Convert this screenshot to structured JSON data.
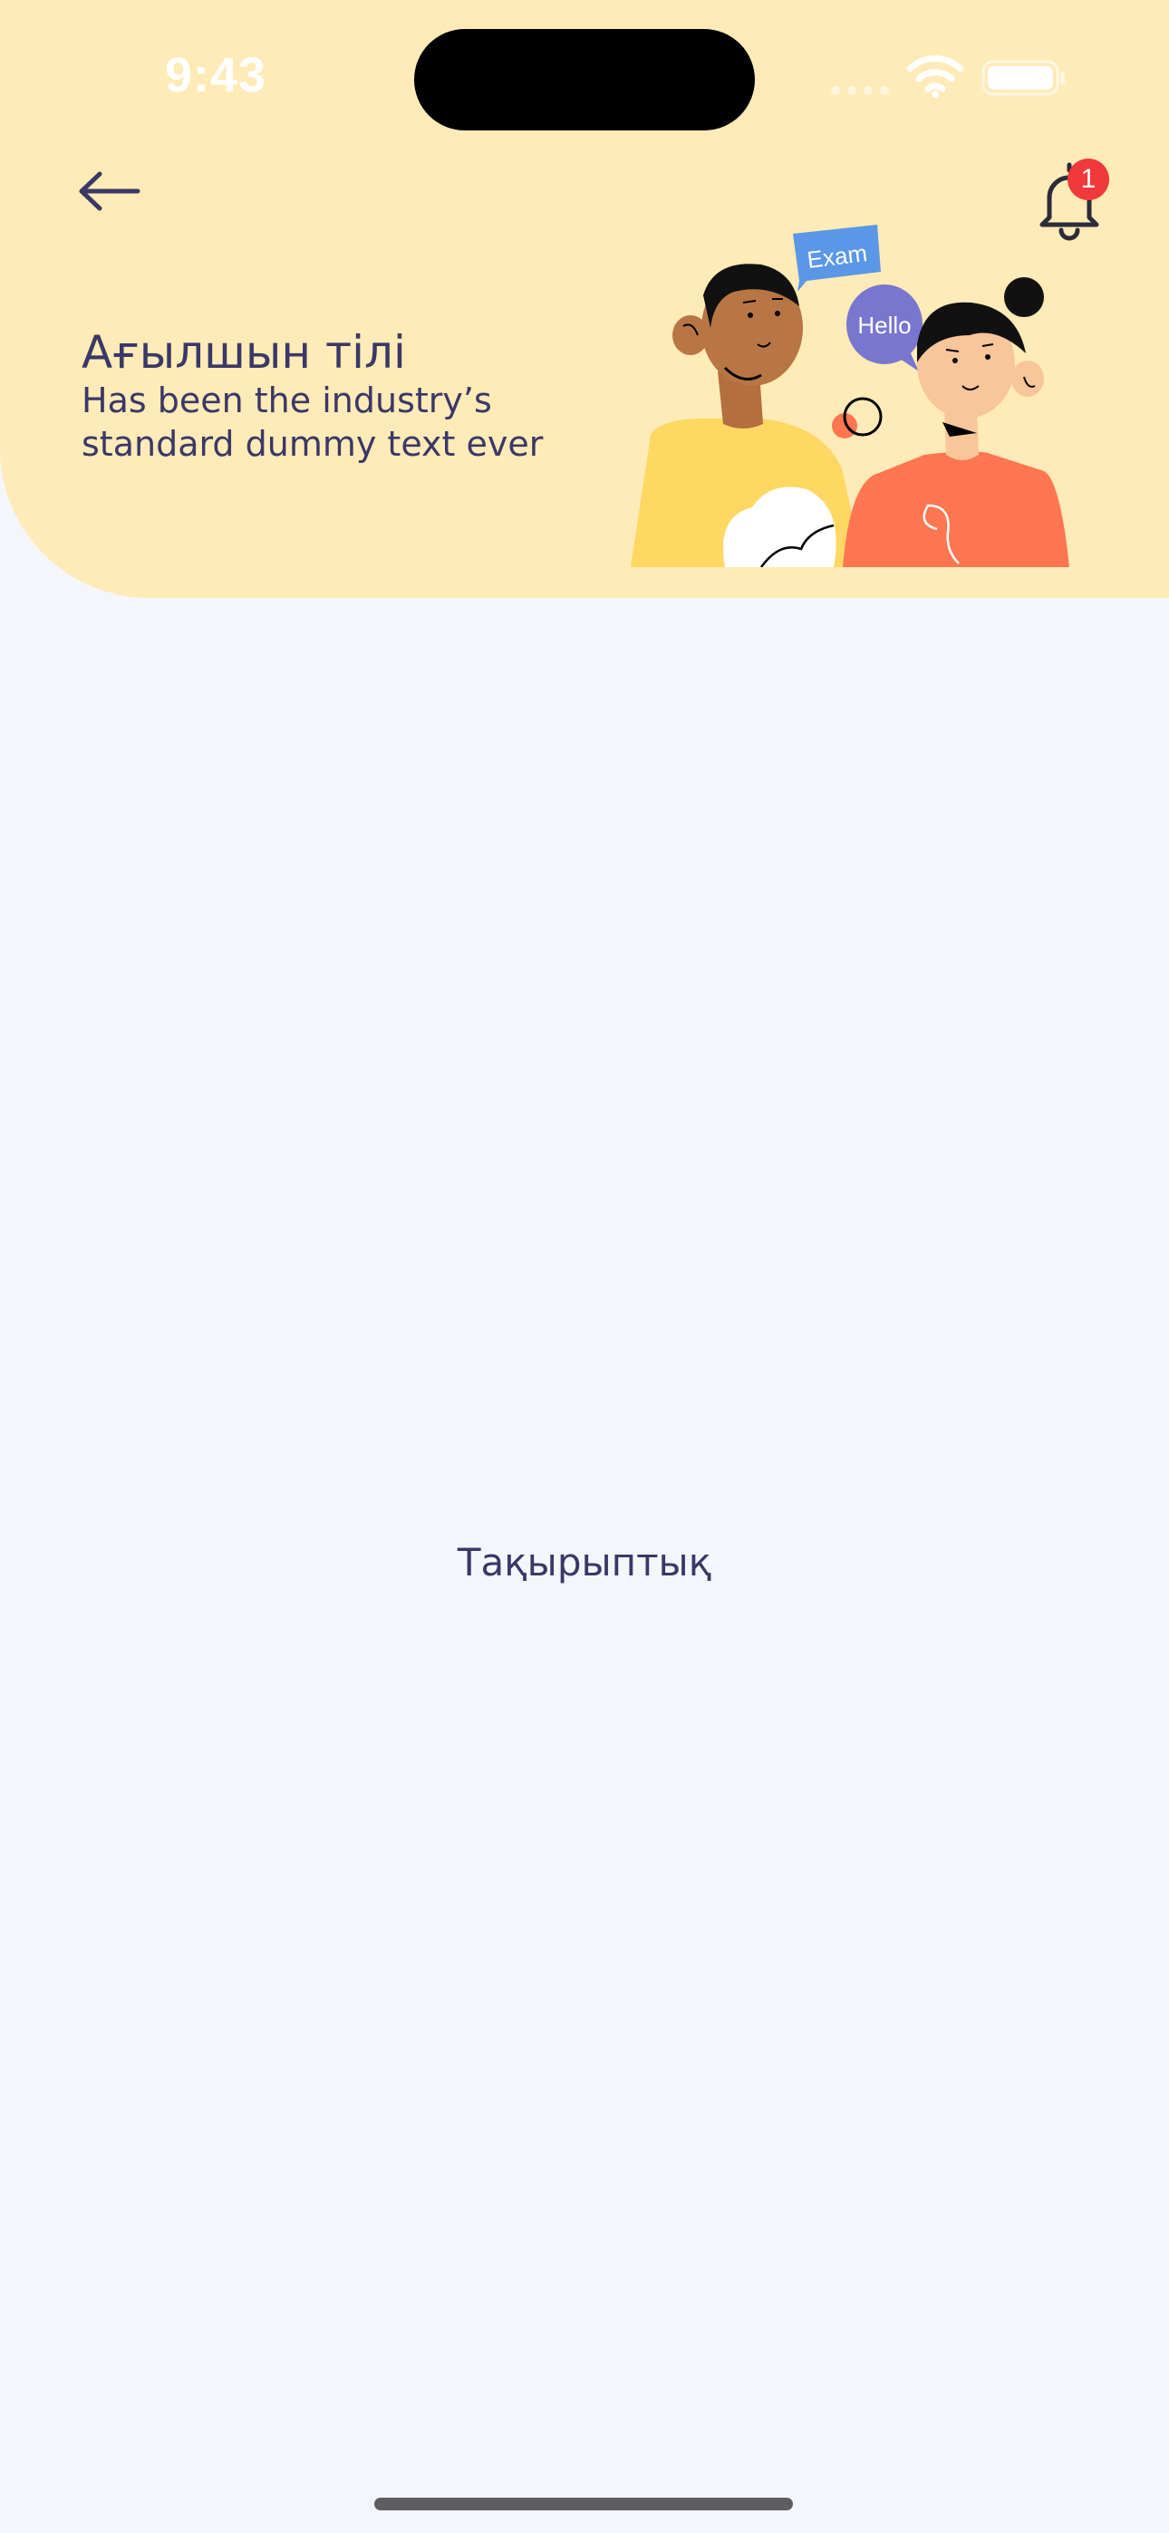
{
  "status_bar": {
    "time": "9:43"
  },
  "header": {
    "title": "Ағылшын тілі",
    "subtitle": "Has been the industry’s standard dummy text ever",
    "notification_count": "1",
    "background_color": "#FFEBB7"
  },
  "illustration": {
    "bubble_exam": "Exam",
    "bubble_hello": "Hello"
  },
  "main": {
    "label": "Тақырыптық"
  },
  "colors": {
    "page_background": "#F4F6FB",
    "text": "#3A3867",
    "badge": "#F0393A"
  }
}
